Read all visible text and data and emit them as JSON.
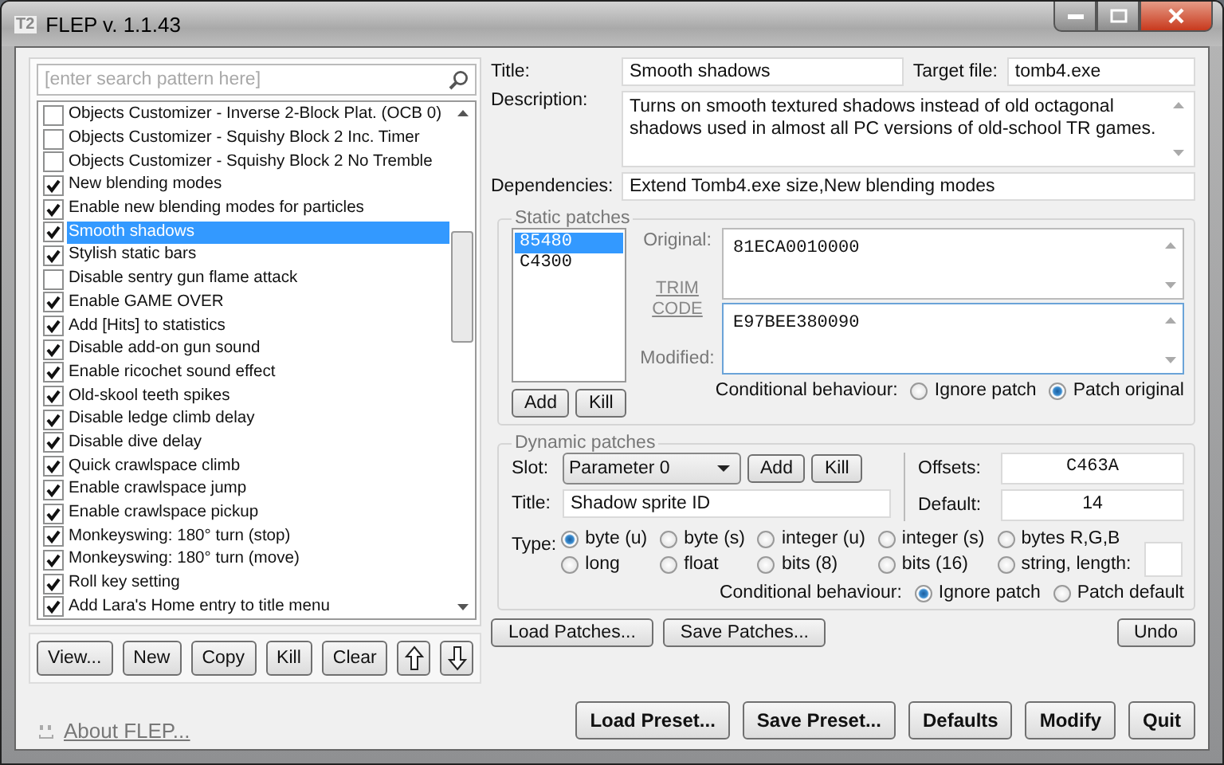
{
  "window": {
    "icon_text": "T2",
    "title": "FLEP v. 1.1.43"
  },
  "search": {
    "placeholder": "[enter search pattern here]"
  },
  "patch_list": [
    {
      "label": "Objects Customizer - Inverse 2-Block Plat. (OCB 0)",
      "checked": false,
      "selected": false
    },
    {
      "label": "Objects Customizer - Squishy Block 2 Inc. Timer",
      "checked": false,
      "selected": false
    },
    {
      "label": "Objects Customizer - Squishy Block 2 No Tremble",
      "checked": false,
      "selected": false
    },
    {
      "label": "New blending modes",
      "checked": true,
      "selected": false
    },
    {
      "label": "Enable new blending modes for particles",
      "checked": true,
      "selected": false
    },
    {
      "label": "Smooth shadows",
      "checked": true,
      "selected": true
    },
    {
      "label": "Stylish static bars",
      "checked": true,
      "selected": false
    },
    {
      "label": "Disable sentry gun flame attack",
      "checked": false,
      "selected": false
    },
    {
      "label": "Enable GAME OVER",
      "checked": true,
      "selected": false
    },
    {
      "label": "Add [Hits] to statistics",
      "checked": true,
      "selected": false
    },
    {
      "label": "Disable add-on gun sound",
      "checked": true,
      "selected": false
    },
    {
      "label": "Enable ricochet sound effect",
      "checked": true,
      "selected": false
    },
    {
      "label": "Old-skool teeth spikes",
      "checked": true,
      "selected": false
    },
    {
      "label": "Disable ledge climb delay",
      "checked": true,
      "selected": false
    },
    {
      "label": "Disable dive delay",
      "checked": true,
      "selected": false
    },
    {
      "label": "Quick crawlspace climb",
      "checked": true,
      "selected": false
    },
    {
      "label": "Enable crawlspace jump",
      "checked": true,
      "selected": false
    },
    {
      "label": "Enable crawlspace pickup",
      "checked": true,
      "selected": false
    },
    {
      "label": "Monkeyswing: 180° turn (stop)",
      "checked": true,
      "selected": false
    },
    {
      "label": "Monkeyswing: 180° turn (move)",
      "checked": true,
      "selected": false
    },
    {
      "label": "Roll key setting",
      "checked": true,
      "selected": false
    },
    {
      "label": "Add Lara's Home entry to title menu",
      "checked": true,
      "selected": false
    }
  ],
  "list_buttons": [
    "View...",
    "New",
    "Copy",
    "Kill",
    "Clear"
  ],
  "about_link": "About FLEP...",
  "details": {
    "title_label": "Title:",
    "title_value": "Smooth shadows",
    "target_label": "Target file:",
    "target_value": "tomb4.exe",
    "description_label": "Description:",
    "description_value": "Turns on smooth textured shadows instead of old octagonal shadows used in almost all PC versions of old-school TR games.",
    "dependencies_label": "Dependencies:",
    "dependencies_value": "Extend Tomb4.exe size,New blending modes"
  },
  "static_patches": {
    "legend": "Static patches",
    "offsets": [
      {
        "label": "85480",
        "selected": true
      },
      {
        "label": "C4300",
        "selected": false
      }
    ],
    "original_label": "Original:",
    "original_value": "81ECA0010000",
    "trim_link": "TRIM CODE",
    "modified_label": "Modified:",
    "modified_value": "E97BEE380090",
    "buttons": [
      "Add",
      "Kill"
    ],
    "conditional_label": "Conditional behaviour:",
    "options": [
      {
        "label": "Ignore patch",
        "selected": false
      },
      {
        "label": "Patch original",
        "selected": true
      }
    ]
  },
  "dynamic_patches": {
    "legend": "Dynamic patches",
    "slot_label": "Slot:",
    "slot_value": "Parameter 0",
    "buttons": [
      "Add",
      "Kill"
    ],
    "title_label": "Title:",
    "title_value": "Shadow sprite ID",
    "offsets_label": "Offsets:",
    "offsets_value": "C463A",
    "default_label": "Default:",
    "default_value": "14",
    "type_label": "Type:",
    "types": [
      {
        "label": "byte (u)",
        "selected": true,
        "kind": "radio"
      },
      {
        "label": "byte (s)",
        "selected": false,
        "kind": "radio"
      },
      {
        "label": "integer (u)",
        "selected": false,
        "kind": "radio"
      },
      {
        "label": "integer (s)",
        "selected": false,
        "kind": "radio"
      },
      {
        "label": "bytes R,G,B",
        "selected": false,
        "kind": "radio"
      },
      {
        "label": "long",
        "selected": false,
        "kind": "radio"
      },
      {
        "label": "float",
        "selected": false,
        "kind": "radio"
      },
      {
        "label": "bits (8)",
        "selected": false,
        "kind": "radio"
      },
      {
        "label": "bits (16)",
        "selected": false,
        "kind": "radio"
      },
      {
        "label": "string, length:",
        "selected": false,
        "kind": "string"
      }
    ],
    "conditional_label": "Conditional behaviour:",
    "options": [
      {
        "label": "Ignore patch",
        "selected": true
      },
      {
        "label": "Patch default",
        "selected": false
      }
    ]
  },
  "patch_buttons": [
    "Load Patches...",
    "Save Patches...",
    "Undo"
  ],
  "footer_buttons": [
    "Load Preset...",
    "Save Preset...",
    "Defaults",
    "Modify",
    "Quit"
  ]
}
